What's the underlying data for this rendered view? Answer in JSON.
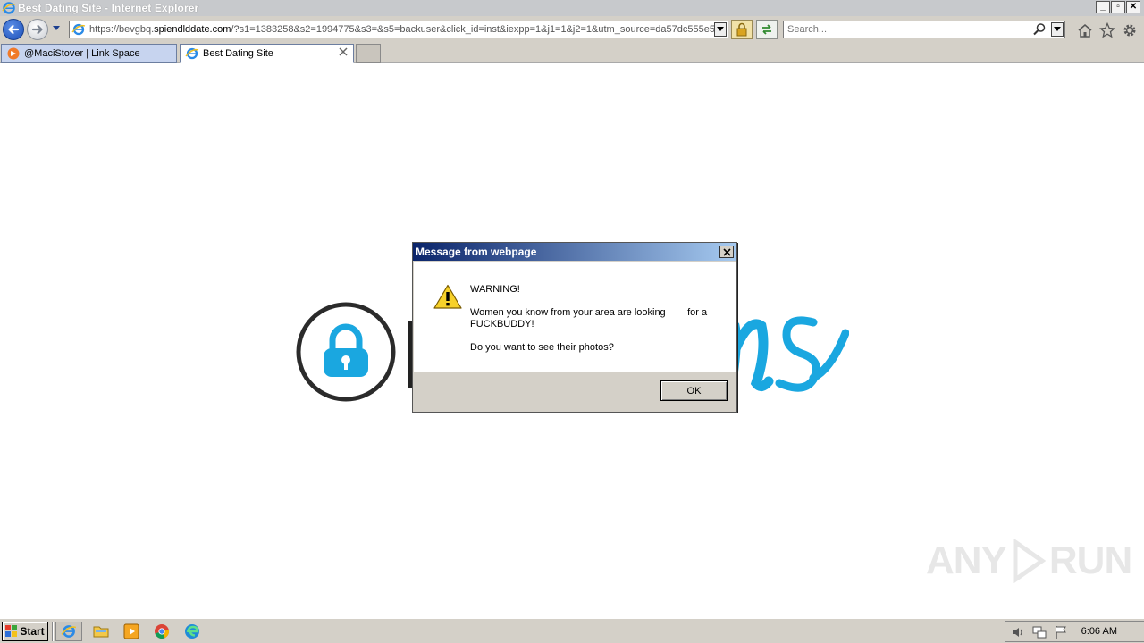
{
  "window": {
    "title": "Best Dating Site - Internet Explorer",
    "controls": {
      "minimize": "_",
      "restore": "▫",
      "close": "✕"
    }
  },
  "toolbar": {
    "address": {
      "prefix": "https://bevgbq.",
      "domain": "spiendlddate.com",
      "rest": "/?s1=1383258&s2=1994775&s3=&s5=backuser&click_id=inst&iexpp=1&j1=1&j2=1&utm_source=da57dc555e5"
    },
    "search": {
      "placeholder": "Search..."
    }
  },
  "tabs": [
    {
      "label": "@MaciStover | Link Space",
      "active": false
    },
    {
      "label": "Best Dating Site",
      "active": true
    }
  ],
  "dialog": {
    "title": "Message from webpage",
    "lines": [
      "WARNING!",
      "Women you know from your area are looking        for a FUCKBUDDY!",
      "Do you want to see their photos?"
    ],
    "ok_label": "OK"
  },
  "watermark": {
    "text_left": "ANY",
    "text_right": "RUN"
  },
  "taskbar": {
    "start_label": "Start",
    "clock": "6:06 AM"
  },
  "colors": {
    "brand_blue": "#1aa7e0",
    "dialog_title_start": "#0a246a",
    "dialog_title_end": "#a6caf0"
  }
}
